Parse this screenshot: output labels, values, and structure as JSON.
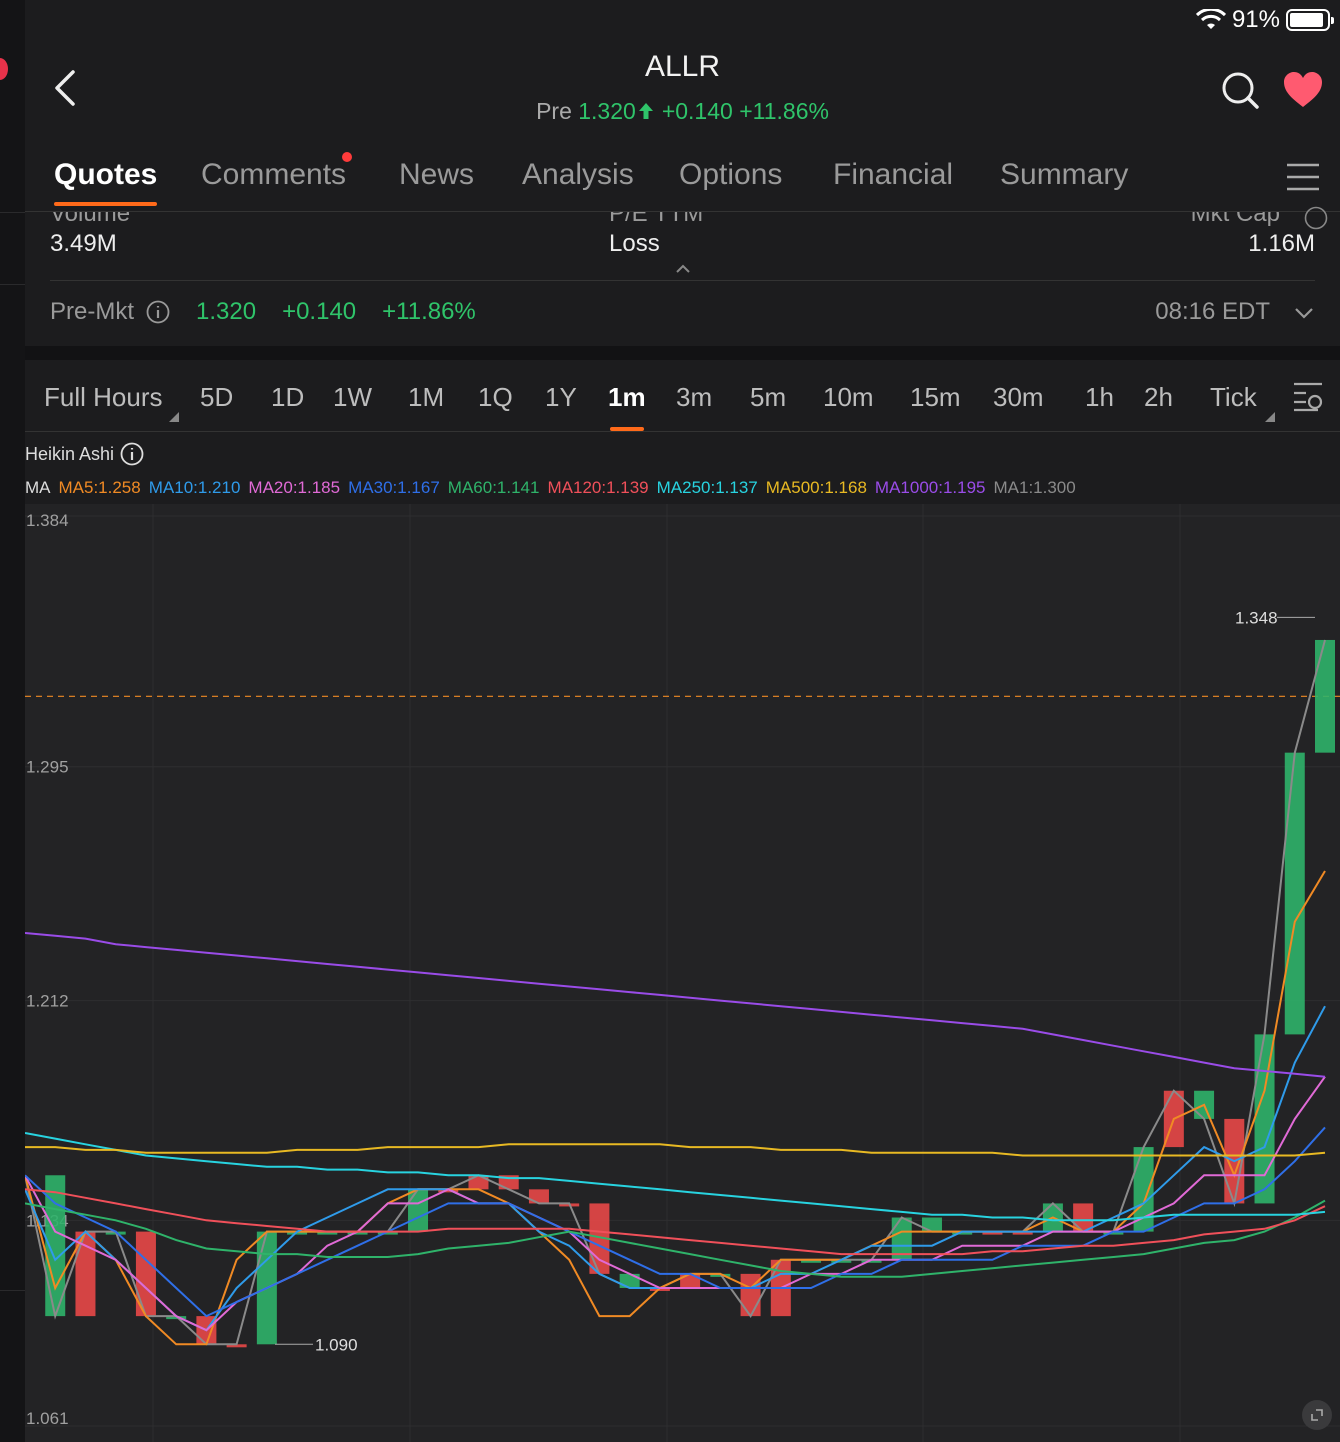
{
  "status": {
    "battery": "91%",
    "battery_level": 0.91
  },
  "header": {
    "title": "ALLR",
    "pre_label": "Pre",
    "price": "1.320",
    "change": "+0.140",
    "change_pct": "+11.86%"
  },
  "tabs": [
    "Quotes",
    "Comments",
    "News",
    "Analysis",
    "Options",
    "Financial",
    "Summary"
  ],
  "active_tab": "Quotes",
  "stats": {
    "volume_label": "Volume",
    "volume": "3.49M",
    "pe_label": "P/E TTM",
    "pe": "Loss",
    "mktcap_label": "Mkt Cap",
    "mktcap": "1.16M"
  },
  "premkt": {
    "label": "Pre-Mkt",
    "price": "1.320",
    "change": "+0.140",
    "change_pct": "+11.86%",
    "time": "08:16 EDT"
  },
  "periods": [
    "Full Hours",
    "5D",
    "1D",
    "1W",
    "1M",
    "1Q",
    "1Y",
    "1m",
    "3m",
    "5m",
    "10m",
    "15m",
    "30m",
    "1h",
    "2h",
    "Tick"
  ],
  "active_period": "1m",
  "chart_type_label": "Heikin Ashi",
  "ma_prefix": "MA",
  "ma_values": [
    {
      "label": "MA5:1.258",
      "color": "#f08a24"
    },
    {
      "label": "MA10:1.210",
      "color": "#2f9bea"
    },
    {
      "label": "MA20:1.185",
      "color": "#e06ad6"
    },
    {
      "label": "MA30:1.167",
      "color": "#2f6fe8"
    },
    {
      "label": "MA60:1.141",
      "color": "#2fb36a"
    },
    {
      "label": "MA120:1.139",
      "color": "#f0505a"
    },
    {
      "label": "MA250:1.137",
      "color": "#28d3e0"
    },
    {
      "label": "MA500:1.168",
      "color": "#e8b923"
    },
    {
      "label": "MA1000:1.195",
      "color": "#9a4ce8"
    },
    {
      "label": "MA1:1.300",
      "color": "#8a8a8a"
    }
  ],
  "chart_data": {
    "type": "line",
    "ytick_labels": [
      "1.384",
      "1.295",
      "1.212",
      "1.134",
      "1.061"
    ],
    "ylim": [
      1.061,
      1.384
    ],
    "high_label": "1.348",
    "low_label": "1.090",
    "reference_price": 1.32,
    "series": [
      {
        "color": "#8a8a8a",
        "values": [
          1.15,
          1.1,
          1.13,
          1.13,
          1.1,
          1.1,
          1.09,
          1.09,
          1.13,
          1.13,
          1.13,
          1.13,
          1.13,
          1.145,
          1.145,
          1.15,
          1.145,
          1.14,
          1.14,
          1.115,
          1.11,
          1.11,
          1.115,
          1.115,
          1.1,
          1.12,
          1.12,
          1.12,
          1.12,
          1.135,
          1.13,
          1.13,
          1.13,
          1.13,
          1.14,
          1.13,
          1.13,
          1.16,
          1.18,
          1.17,
          1.14,
          1.2,
          1.3,
          1.34
        ]
      },
      {
        "color": "#f08a24",
        "values": [
          1.15,
          1.11,
          1.13,
          1.12,
          1.1,
          1.09,
          1.09,
          1.12,
          1.13,
          1.13,
          1.13,
          1.13,
          1.14,
          1.145,
          1.145,
          1.145,
          1.14,
          1.13,
          1.12,
          1.1,
          1.1,
          1.11,
          1.115,
          1.115,
          1.11,
          1.12,
          1.12,
          1.12,
          1.125,
          1.13,
          1.13,
          1.13,
          1.13,
          1.13,
          1.135,
          1.13,
          1.13,
          1.14,
          1.17,
          1.175,
          1.15,
          1.18,
          1.24,
          1.258
        ]
      },
      {
        "color": "#2f9bea",
        "values": [
          1.145,
          1.12,
          1.13,
          1.12,
          1.11,
          1.1,
          1.095,
          1.11,
          1.12,
          1.13,
          1.135,
          1.14,
          1.145,
          1.145,
          1.145,
          1.14,
          1.14,
          1.13,
          1.125,
          1.115,
          1.11,
          1.11,
          1.11,
          1.11,
          1.11,
          1.115,
          1.115,
          1.12,
          1.125,
          1.125,
          1.125,
          1.13,
          1.13,
          1.13,
          1.13,
          1.13,
          1.135,
          1.14,
          1.15,
          1.16,
          1.155,
          1.16,
          1.19,
          1.21
        ]
      },
      {
        "color": "#e06ad6",
        "values": [
          1.15,
          1.13,
          1.125,
          1.12,
          1.11,
          1.1,
          1.095,
          1.105,
          1.11,
          1.115,
          1.125,
          1.13,
          1.14,
          1.14,
          1.145,
          1.14,
          1.14,
          1.135,
          1.13,
          1.12,
          1.115,
          1.11,
          1.11,
          1.11,
          1.11,
          1.11,
          1.115,
          1.115,
          1.12,
          1.12,
          1.12,
          1.125,
          1.125,
          1.125,
          1.13,
          1.13,
          1.13,
          1.135,
          1.14,
          1.15,
          1.15,
          1.15,
          1.17,
          1.185
        ]
      },
      {
        "color": "#2f6fe8",
        "values": [
          1.15,
          1.14,
          1.135,
          1.13,
          1.12,
          1.11,
          1.1,
          1.105,
          1.11,
          1.115,
          1.12,
          1.125,
          1.13,
          1.135,
          1.14,
          1.14,
          1.14,
          1.135,
          1.13,
          1.125,
          1.12,
          1.115,
          1.115,
          1.11,
          1.11,
          1.11,
          1.11,
          1.115,
          1.115,
          1.12,
          1.12,
          1.12,
          1.12,
          1.125,
          1.125,
          1.125,
          1.13,
          1.13,
          1.135,
          1.14,
          1.14,
          1.145,
          1.155,
          1.167
        ]
      },
      {
        "color": "#2fb36a",
        "values": [
          1.14,
          1.138,
          1.136,
          1.134,
          1.131,
          1.127,
          1.124,
          1.123,
          1.122,
          1.122,
          1.121,
          1.121,
          1.121,
          1.122,
          1.124,
          1.125,
          1.126,
          1.128,
          1.13,
          1.128,
          1.126,
          1.124,
          1.122,
          1.12,
          1.118,
          1.116,
          1.115,
          1.114,
          1.114,
          1.114,
          1.115,
          1.116,
          1.117,
          1.118,
          1.119,
          1.12,
          1.121,
          1.122,
          1.124,
          1.126,
          1.127,
          1.13,
          1.135,
          1.141
        ]
      },
      {
        "color": "#f0505a",
        "values": [
          1.145,
          1.144,
          1.142,
          1.14,
          1.138,
          1.136,
          1.134,
          1.133,
          1.132,
          1.131,
          1.13,
          1.13,
          1.13,
          1.13,
          1.131,
          1.131,
          1.131,
          1.131,
          1.131,
          1.13,
          1.129,
          1.128,
          1.127,
          1.126,
          1.125,
          1.124,
          1.123,
          1.122,
          1.122,
          1.122,
          1.122,
          1.122,
          1.123,
          1.123,
          1.124,
          1.125,
          1.125,
          1.126,
          1.127,
          1.129,
          1.13,
          1.131,
          1.134,
          1.139
        ]
      },
      {
        "color": "#28d3e0",
        "values": [
          1.165,
          1.163,
          1.161,
          1.159,
          1.157,
          1.156,
          1.155,
          1.154,
          1.153,
          1.153,
          1.152,
          1.152,
          1.151,
          1.151,
          1.15,
          1.15,
          1.149,
          1.149,
          1.148,
          1.147,
          1.146,
          1.145,
          1.144,
          1.143,
          1.142,
          1.141,
          1.14,
          1.139,
          1.138,
          1.137,
          1.136,
          1.136,
          1.135,
          1.135,
          1.134,
          1.134,
          1.134,
          1.135,
          1.136,
          1.136,
          1.136,
          1.136,
          1.136,
          1.137
        ]
      },
      {
        "color": "#e8b923",
        "values": [
          1.16,
          1.16,
          1.159,
          1.159,
          1.158,
          1.158,
          1.158,
          1.158,
          1.158,
          1.159,
          1.159,
          1.159,
          1.16,
          1.16,
          1.16,
          1.16,
          1.161,
          1.161,
          1.161,
          1.161,
          1.161,
          1.161,
          1.16,
          1.16,
          1.16,
          1.159,
          1.159,
          1.159,
          1.158,
          1.158,
          1.158,
          1.158,
          1.158,
          1.157,
          1.157,
          1.157,
          1.157,
          1.157,
          1.157,
          1.157,
          1.157,
          1.157,
          1.157,
          1.158
        ]
      },
      {
        "color": "#9a4ce8",
        "values": [
          1.236,
          1.235,
          1.234,
          1.232,
          1.231,
          1.23,
          1.229,
          1.228,
          1.227,
          1.226,
          1.225,
          1.224,
          1.223,
          1.222,
          1.221,
          1.22,
          1.219,
          1.218,
          1.217,
          1.216,
          1.215,
          1.214,
          1.213,
          1.212,
          1.211,
          1.21,
          1.209,
          1.208,
          1.207,
          1.206,
          1.205,
          1.204,
          1.203,
          1.202,
          1.2,
          1.198,
          1.196,
          1.194,
          1.192,
          1.19,
          1.188,
          1.187,
          1.186,
          1.185
        ]
      }
    ],
    "bars": [
      1,
      1,
      0,
      1,
      0,
      1,
      0,
      0,
      1,
      1,
      1,
      1,
      1,
      1,
      0,
      0,
      0,
      0,
      0,
      0,
      1,
      0,
      0,
      1,
      0,
      0,
      1,
      1,
      1,
      1,
      1,
      1,
      0,
      0,
      1,
      0,
      1,
      1,
      0,
      1,
      0,
      1,
      1,
      1
    ]
  }
}
